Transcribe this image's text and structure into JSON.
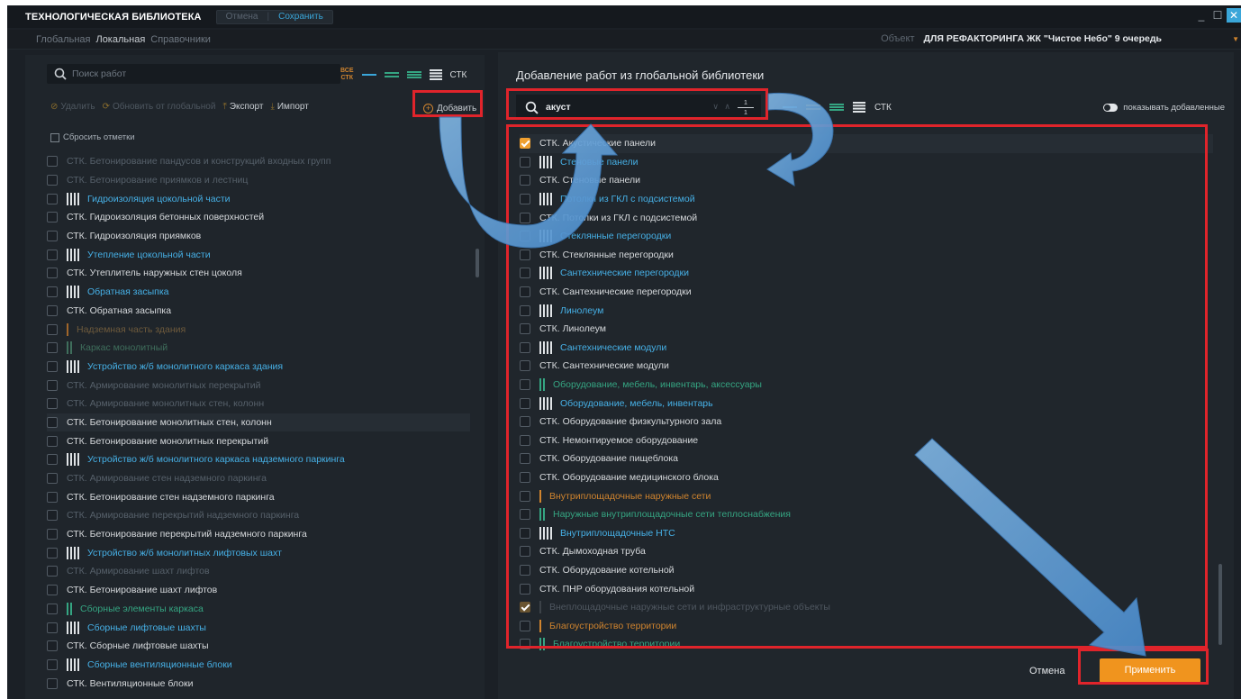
{
  "app": {
    "title": "ТЕХНОЛОГИЧЕСКАЯ БИБЛИОТЕКА",
    "cancel_label": "Отмена",
    "save_label": "Сохранить"
  },
  "window_controls": [
    "_",
    "☐",
    "✕"
  ],
  "menu": {
    "tabs": [
      "Глобальная",
      "Локальная",
      "Справочники"
    ],
    "active_tab": "Локальная",
    "object_label": "Объект",
    "object_value": "ДЛЯ РЕФАКТОРИНГА ЖК \"Чистое Небо\" 9 очередь"
  },
  "left": {
    "search_placeholder": "Поиск работ",
    "view_all_label": "ВСЕ СТК",
    "view_all_line1": "ВСЕ",
    "view_all_line2": "СТК",
    "view_stk_label": "СТК",
    "toolbar": {
      "delete_label": "Удалить",
      "update_label": "Обновить от глобальной",
      "export_label": "Экспорт",
      "import_label": "Импорт",
      "add_label": "Добавить"
    },
    "reset_label": "Сбросить отметки",
    "items": [
      {
        "text": "СТК. Бетонирование пандусов и конструкций входных групп",
        "color": "dim",
        "bars": []
      },
      {
        "text": "СТК. Бетонирование приямков и лестниц",
        "color": "dim",
        "bars": []
      },
      {
        "text": "Гидроизоляция цокольной части",
        "color": "blue",
        "bars": [
          "#dfe3e6",
          "#dfe3e6",
          "#dfe3e6",
          "#dfe3e6"
        ]
      },
      {
        "text": "СТК. Гидроизоляция бетонных поверхностей",
        "color": "white",
        "bars": []
      },
      {
        "text": "СТК. Гидроизоляция приямков",
        "color": "white",
        "bars": []
      },
      {
        "text": "Утепление цокольной части",
        "color": "blue",
        "bars": [
          "#dfe3e6",
          "#dfe3e6",
          "#dfe3e6",
          "#dfe3e6"
        ]
      },
      {
        "text": "СТК. Утеплитель наружных стен цоколя",
        "color": "white",
        "bars": []
      },
      {
        "text": "Обратная засыпка",
        "color": "blue",
        "bars": [
          "#dfe3e6",
          "#dfe3e6",
          "#dfe3e6",
          "#dfe3e6"
        ]
      },
      {
        "text": "СТК. Обратная засыпка",
        "color": "white",
        "bars": []
      },
      {
        "text": "Надземная часть здания",
        "color": "dimorange",
        "bars": [
          "#a0662a"
        ]
      },
      {
        "text": "Каркас монолитный",
        "color": "dimgreen",
        "bars": [
          "#3f6e5c",
          "#3f6e5c"
        ]
      },
      {
        "text": "Устройство ж/б монолитного каркаса здания",
        "color": "blue",
        "bars": [
          "#dfe3e6",
          "#dfe3e6",
          "#dfe3e6",
          "#dfe3e6"
        ]
      },
      {
        "text": "СТК. Армирование монолитных перекрытий",
        "color": "dim",
        "bars": []
      },
      {
        "text": "СТК. Армирование монолитных стен, колонн",
        "color": "dim",
        "bars": []
      },
      {
        "text": "СТК. Бетонирование монолитных стен, колонн",
        "color": "white",
        "bars": [],
        "highlight": true
      },
      {
        "text": "СТК. Бетонирование монолитных перекрытий",
        "color": "white",
        "bars": []
      },
      {
        "text": "Устройство ж/б монолитного каркаса надземного паркинга",
        "color": "blue",
        "bars": [
          "#dfe3e6",
          "#dfe3e6",
          "#dfe3e6",
          "#dfe3e6"
        ]
      },
      {
        "text": "СТК. Армирование стен надземного паркинга",
        "color": "dim",
        "bars": []
      },
      {
        "text": "СТК. Бетонирование стен надземного паркинга",
        "color": "white",
        "bars": []
      },
      {
        "text": "СТК. Армирование перекрытий надземного паркинга",
        "color": "dim",
        "bars": []
      },
      {
        "text": "СТК. Бетонирование перекрытий надземного паркинга",
        "color": "white",
        "bars": []
      },
      {
        "text": "Устройство ж/б монолитных лифтовых шахт",
        "color": "blue",
        "bars": [
          "#dfe3e6",
          "#dfe3e6",
          "#dfe3e6",
          "#dfe3e6"
        ]
      },
      {
        "text": "СТК. Армирование шахт лифтов",
        "color": "dim",
        "bars": []
      },
      {
        "text": "СТК. Бетонирование шахт лифтов",
        "color": "white",
        "bars": []
      },
      {
        "text": "Сборные элементы каркаса",
        "color": "green",
        "bars": [
          "#35a582",
          "#35a582"
        ]
      },
      {
        "text": "Сборные лифтовые шахты",
        "color": "blue",
        "bars": [
          "#dfe3e6",
          "#dfe3e6",
          "#dfe3e6",
          "#dfe3e6"
        ]
      },
      {
        "text": "СТК. Сборные лифтовые шахты",
        "color": "white",
        "bars": []
      },
      {
        "text": "Сборные вентиляционные блоки",
        "color": "blue",
        "bars": [
          "#dfe3e6",
          "#dfe3e6",
          "#dfe3e6",
          "#dfe3e6"
        ]
      },
      {
        "text": "СТК. Вентиляционные блоки",
        "color": "white",
        "bars": []
      }
    ]
  },
  "dialog": {
    "title": "Добавление работ из глобальной библиотеки",
    "search_value": "акуст",
    "search_nav": "∨ ∧",
    "match_current": "1",
    "match_total": "1",
    "view_stk_label": "СТК",
    "show_added_label": "показывать добавленные",
    "items": [
      {
        "text": "СТК. Акустические панели",
        "color": "white",
        "bars": [],
        "checked": true,
        "highlight": true
      },
      {
        "text": "Стеновые панели",
        "color": "blue",
        "bars": [
          "#dfe3e6",
          "#dfe3e6",
          "#dfe3e6",
          "#dfe3e6"
        ]
      },
      {
        "text": "СТК. Стеновые панели",
        "color": "white",
        "bars": []
      },
      {
        "text": "Потолки из ГКЛ с подсистемой",
        "color": "blue",
        "bars": [
          "#dfe3e6",
          "#dfe3e6",
          "#dfe3e6",
          "#dfe3e6"
        ]
      },
      {
        "text": "СТК. Потолки из ГКЛ с подсистемой",
        "color": "white",
        "bars": []
      },
      {
        "text": "Стеклянные перегородки",
        "color": "blue",
        "bars": [
          "#dfe3e6",
          "#dfe3e6",
          "#dfe3e6",
          "#dfe3e6"
        ]
      },
      {
        "text": "СТК. Стеклянные перегородки",
        "color": "white",
        "bars": []
      },
      {
        "text": "Сантехнические перегородки",
        "color": "blue",
        "bars": [
          "#dfe3e6",
          "#dfe3e6",
          "#dfe3e6",
          "#dfe3e6"
        ]
      },
      {
        "text": "СТК. Сантехнические перегородки",
        "color": "white",
        "bars": []
      },
      {
        "text": "Линолеум",
        "color": "blue",
        "bars": [
          "#dfe3e6",
          "#dfe3e6",
          "#dfe3e6",
          "#dfe3e6"
        ]
      },
      {
        "text": "СТК. Линолеум",
        "color": "white",
        "bars": []
      },
      {
        "text": "Сантехнические модули",
        "color": "blue",
        "bars": [
          "#dfe3e6",
          "#dfe3e6",
          "#dfe3e6",
          "#dfe3e6"
        ]
      },
      {
        "text": "СТК. Сантехнические модули",
        "color": "white",
        "bars": []
      },
      {
        "text": "Оборудование, мебель, инвентарь, аксессуары",
        "color": "green",
        "bars": [
          "#35a582",
          "#35a582"
        ]
      },
      {
        "text": "Оборудование, мебель, инвентарь",
        "color": "blue",
        "bars": [
          "#dfe3e6",
          "#dfe3e6",
          "#dfe3e6",
          "#dfe3e6"
        ]
      },
      {
        "text": "СТК. Оборудование физкультурного зала",
        "color": "white",
        "bars": []
      },
      {
        "text": "СТК. Немонтируемое оборудование",
        "color": "white",
        "bars": []
      },
      {
        "text": "СТК. Оборудование пищеблока",
        "color": "white",
        "bars": []
      },
      {
        "text": "СТК. Оборудование медицинского блока",
        "color": "white",
        "bars": []
      },
      {
        "text": "Внутриплощадочные наружные сети",
        "color": "orange",
        "bars": [
          "#d0842e"
        ]
      },
      {
        "text": "Наружные внутриплощадочные сети теплоснабжения",
        "color": "green",
        "bars": [
          "#35a582",
          "#35a582"
        ]
      },
      {
        "text": "Внутриплощадочные НТС",
        "color": "blue",
        "bars": [
          "#dfe3e6",
          "#dfe3e6",
          "#dfe3e6",
          "#dfe3e6"
        ]
      },
      {
        "text": "СТК. Дымоходная труба",
        "color": "white",
        "bars": []
      },
      {
        "text": "СТК. Оборудование котельной",
        "color": "white",
        "bars": []
      },
      {
        "text": "СТК. ПНР оборудования котельной",
        "color": "white",
        "bars": []
      },
      {
        "text": "Внеплощадочные наружные сети и инфраструктурные объекты",
        "color": "dimgray",
        "bars": [
          "#3c4248"
        ],
        "checked": true,
        "faint": true
      },
      {
        "text": "Благоустройство территории",
        "color": "orange",
        "bars": [
          "#d0842e"
        ]
      },
      {
        "text": "Благоустройство территории",
        "color": "green",
        "bars": [
          "#35a582",
          "#35a582"
        ]
      }
    ],
    "cancel_label": "Отмена",
    "apply_label": "Применить"
  },
  "colors": {
    "accent_orange": "#f0941e",
    "accent_blue": "#3aa6d9",
    "annotation_red": "#e0242b",
    "annotation_arrow": "#5b9bd5"
  }
}
